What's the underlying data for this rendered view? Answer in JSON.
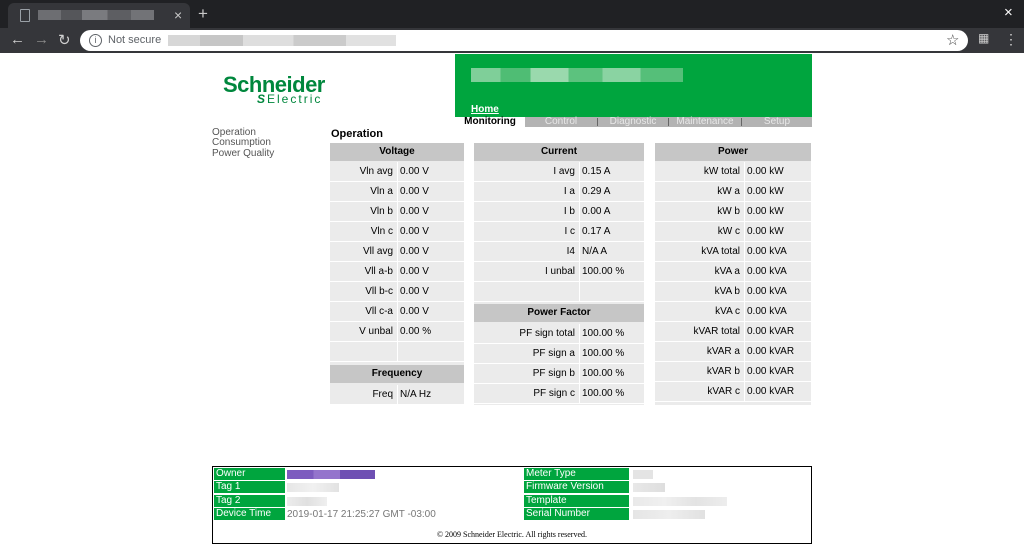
{
  "browser": {
    "tab_close": "×",
    "new_tab": "+",
    "window_close": "×",
    "back": "←",
    "forward": "→",
    "reload": "↻",
    "not_secure": "Not secure",
    "star": "☆",
    "menu": "⋮"
  },
  "logo": {
    "name": "Schneider",
    "sub": "Electric"
  },
  "banner": {
    "home": "Home"
  },
  "nav_tabs": [
    "Monitoring",
    "Control",
    "Diagnostic",
    "Maintenance",
    "Setup"
  ],
  "sidebar": {
    "items": [
      "Operation",
      "Consumption",
      "Power Quality"
    ]
  },
  "page_title": "Operation",
  "voltage": {
    "title": "Voltage",
    "rows": [
      {
        "label": "Vln avg",
        "value": "0.00 V"
      },
      {
        "label": "Vln a",
        "value": "0.00 V"
      },
      {
        "label": "Vln b",
        "value": "0.00 V"
      },
      {
        "label": "Vln c",
        "value": "0.00 V"
      },
      {
        "label": "Vll avg",
        "value": "0.00 V"
      },
      {
        "label": "Vll a-b",
        "value": "0.00 V"
      },
      {
        "label": "Vll b-c",
        "value": "0.00 V"
      },
      {
        "label": "Vll c-a",
        "value": "0.00 V"
      },
      {
        "label": "V unbal",
        "value": "0.00 %"
      },
      {
        "label": "",
        "value": ""
      }
    ]
  },
  "frequency": {
    "title": "Frequency",
    "rows": [
      {
        "label": "Freq",
        "value": "N/A Hz"
      }
    ]
  },
  "current": {
    "title": "Current",
    "rows": [
      {
        "label": "I avg",
        "value": "0.15 A"
      },
      {
        "label": "I a",
        "value": "0.29 A"
      },
      {
        "label": "I b",
        "value": "0.00 A"
      },
      {
        "label": "I c",
        "value": "0.17 A"
      },
      {
        "label": "I4",
        "value": "N/A A"
      },
      {
        "label": "I unbal",
        "value": "100.00 %"
      },
      {
        "label": "",
        "value": ""
      }
    ]
  },
  "power_factor": {
    "title": "Power Factor",
    "rows": [
      {
        "label": "PF sign total",
        "value": "100.00 %"
      },
      {
        "label": "PF sign a",
        "value": "100.00 %"
      },
      {
        "label": "PF sign b",
        "value": "100.00 %"
      },
      {
        "label": "PF sign c",
        "value": "100.00 %"
      }
    ]
  },
  "power": {
    "title": "Power",
    "rows": [
      {
        "label": "kW total",
        "value": "0.00 kW"
      },
      {
        "label": "kW a",
        "value": "0.00 kW"
      },
      {
        "label": "kW b",
        "value": "0.00 kW"
      },
      {
        "label": "kW c",
        "value": "0.00 kW"
      },
      {
        "label": "kVA total",
        "value": "0.00 kVA"
      },
      {
        "label": "kVA a",
        "value": "0.00 kVA"
      },
      {
        "label": "kVA b",
        "value": "0.00 kVA"
      },
      {
        "label": "kVA c",
        "value": "0.00 kVA"
      },
      {
        "label": "kVAR total",
        "value": "0.00 kVAR"
      },
      {
        "label": "kVAR a",
        "value": "0.00 kVAR"
      },
      {
        "label": "kVAR b",
        "value": "0.00 kVAR"
      },
      {
        "label": "kVAR c",
        "value": "0.00 kVAR"
      }
    ]
  },
  "footer": {
    "left_labels": [
      "Owner",
      "Tag 1",
      "Tag 2",
      "Device Time"
    ],
    "device_time": "2019-01-17 21:25:27   GMT -03:00",
    "right_labels": [
      "Meter Type",
      "Firmware Version",
      "Template",
      "Serial Number"
    ],
    "copyright": "© 2009 Schneider Electric. All rights reserved."
  },
  "colors": {
    "brand_green": "#00a53e",
    "logo_green": "#00873d",
    "table_header": "#c6c6c6",
    "table_cell": "#ebebeb"
  }
}
